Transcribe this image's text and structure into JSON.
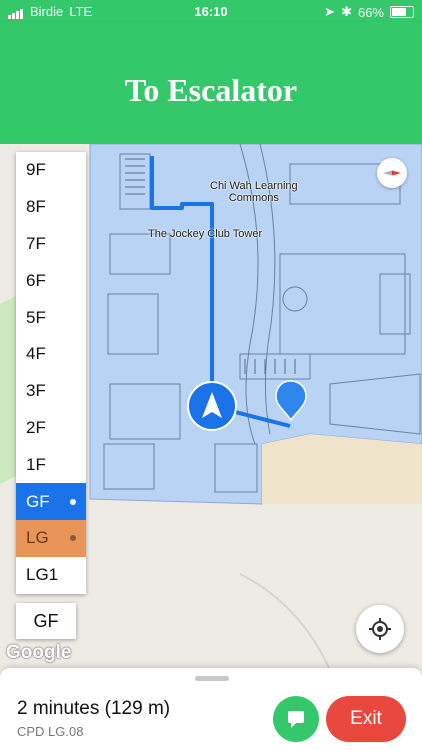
{
  "status_bar": {
    "carrier": "Birdie",
    "network": "LTE",
    "time": "16:10",
    "battery": "66%"
  },
  "header": {
    "title": "To Escalator"
  },
  "map": {
    "labels": {
      "building_1": "Chi Wah Learning\nCommons",
      "building_2": "The Jockey Club Tower"
    },
    "logo": "Google"
  },
  "floors": {
    "items": [
      {
        "label": "9F"
      },
      {
        "label": "8F"
      },
      {
        "label": "7F"
      },
      {
        "label": "6F"
      },
      {
        "label": "5F"
      },
      {
        "label": "4F"
      },
      {
        "label": "3F"
      },
      {
        "label": "2F"
      },
      {
        "label": "1F"
      },
      {
        "label": "GF"
      },
      {
        "label": "LG"
      },
      {
        "label": "LG1"
      }
    ],
    "selected": "GF",
    "current_floor_button": "GF"
  },
  "route": {
    "eta": "2 minutes (129 m)",
    "destination_code": "CPD LG.08"
  },
  "actions": {
    "exit_label": "Exit"
  },
  "colors": {
    "accent_green": "#35c86a",
    "route_blue": "#1a73e8",
    "exit_red": "#e8493c",
    "lg_floor": "#e8955a"
  }
}
